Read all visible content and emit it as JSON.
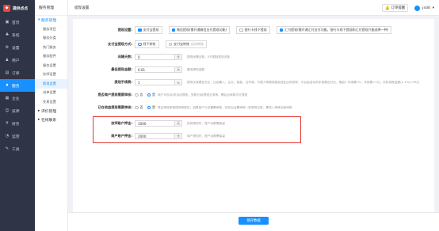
{
  "nav": {
    "brand": "提供点点",
    "items": [
      {
        "label": "首页",
        "icon": "home-icon",
        "glyph": "▣",
        "active": false
      },
      {
        "label": "系统",
        "icon": "system-icon",
        "glyph": "♣",
        "active": false
      },
      {
        "label": "设置",
        "icon": "gear-icon",
        "glyph": "⚙",
        "active": false
      },
      {
        "label": "用户",
        "icon": "user-icon",
        "glyph": "♟",
        "active": false
      },
      {
        "label": "订单",
        "icon": "order-icon",
        "glyph": "▤",
        "active": false
      },
      {
        "label": "服务",
        "icon": "service-icon",
        "glyph": "♦",
        "active": true
      },
      {
        "label": "企业",
        "icon": "enterprise-icon",
        "glyph": "▦",
        "active": false
      },
      {
        "label": "技师",
        "icon": "technician-icon",
        "glyph": "☺",
        "active": false
      },
      {
        "label": "财务",
        "icon": "finance-icon",
        "glyph": "¥",
        "active": false
      },
      {
        "label": "运营",
        "icon": "operation-icon",
        "glyph": "◔",
        "active": false
      },
      {
        "label": "工具",
        "icon": "tool-icon",
        "glyph": "✎",
        "active": false
      }
    ]
  },
  "subnav": {
    "header": "服务管理",
    "group_open": "服务管理",
    "subs": [
      {
        "label": "服务项目",
        "active": false
      },
      {
        "label": "服务分类",
        "active": false
      },
      {
        "label": "热门服务",
        "active": false
      },
      {
        "label": "服务配件",
        "active": false
      },
      {
        "label": "服务设置",
        "active": false
      },
      {
        "label": "技师设置",
        "active": false
      },
      {
        "label": "提现设置",
        "active": true
      },
      {
        "label": "派单设置",
        "active": false
      },
      {
        "label": "交易设置",
        "active": false
      }
    ],
    "group2": "评价管理",
    "group3": "在线联系"
  },
  "topbar": {
    "breadcrumb": "提现设置",
    "todo": "订单提醒",
    "username": "jsdd"
  },
  "form": {
    "row1": {
      "label": "提现设置:",
      "opts": [
        "支付宝提现",
        "微信提现(需开通微信支付提现功能)",
        "银行卡线下提现",
        "汇付提现(需开通汇付支付功能，银行卡线下提现和汇付提现只能选择一种)"
      ]
    },
    "row2": {
      "label": "支付宝提现方式:",
      "opts": [
        "线下转账",
        "支付宝转账"
      ],
      "hint": "自动转账"
    },
    "row3": {
      "label": "间隔天数:",
      "value": "0",
      "unit": "天",
      "hint": "提现间隔天数，0不限制提现天数"
    },
    "row4": {
      "label": "最低提现金额:",
      "value": "0.01",
      "unit": "元",
      "hint": "最低提现金额"
    },
    "row5": {
      "label": "提现手续费:",
      "value": "1",
      "unit": "%",
      "hint": "提现手续费百分比，比如输入，企业、智能、合作商、代理人等提现都会按此比例扣除，平台会自动扣手续费百分比，假如1 手续费1%，手续费=1元，实际到账金额(1-1%)=99元"
    },
    "row6": {
      "label": "是否商户提现需要审核:",
      "opts": [
        "否",
        "是"
      ],
      "hint": "商户可自动/非自动提现，关联分润/提现记录等，需后台审核才可提现"
    },
    "row7": {
      "label": "已在收益提现需要审核:",
      "opts": [
        "否",
        "是"
      ],
      "hint": "是否单独审核提现审核的，如果商户已设置需审核，则在后台需审核一条提现记录，需进入审核页面审核"
    },
    "row8": {
      "label": "技师账户押金:",
      "value": "1000",
      "unit": "元",
      "hint": "技师提现时，账户余额需保留"
    },
    "row9": {
      "label": "商户账户押金:",
      "value": "2000",
      "unit": "元",
      "hint": "商户提现时，账户余额需保留"
    }
  },
  "footer": {
    "submit": "保存数据"
  }
}
